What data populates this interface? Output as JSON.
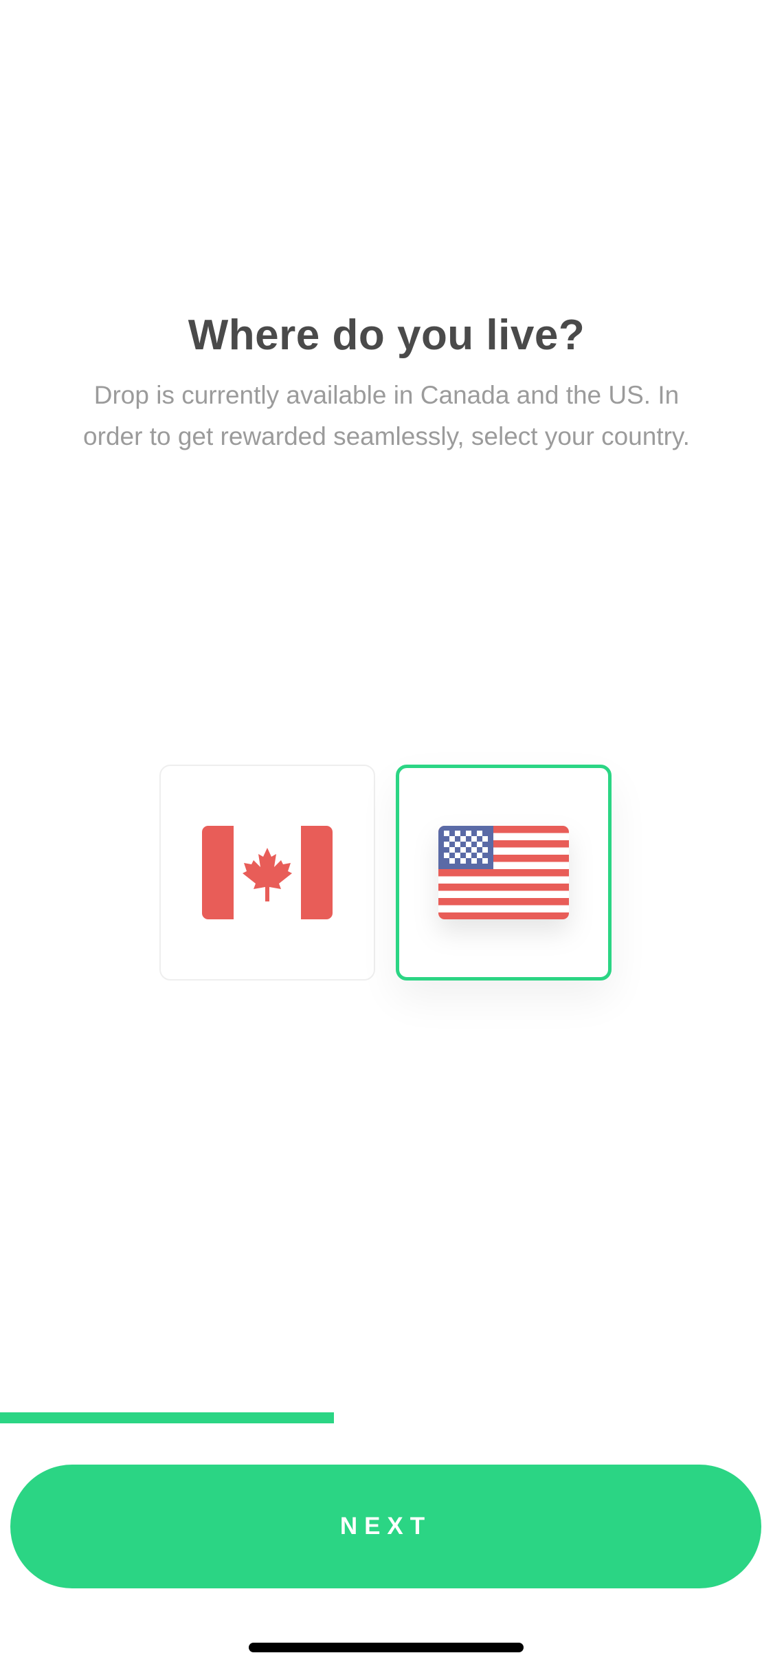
{
  "header": {
    "title": "Where do you live?",
    "subtitle": "Drop is currently available in Canada and the US. In order to get rewarded seamlessly, select your country."
  },
  "countries": [
    {
      "code": "CA",
      "icon": "canada-flag-icon",
      "selected": false
    },
    {
      "code": "US",
      "icon": "usa-flag-icon",
      "selected": true
    }
  ],
  "progress": {
    "fraction": 0.432
  },
  "footer": {
    "next_label": "NEXT"
  },
  "colors": {
    "accent": "#2bd584",
    "flag_red": "#e85d58",
    "flag_blue": "#5a6aa6",
    "title": "#4a4a4a",
    "subtitle": "#9b9b9b"
  }
}
